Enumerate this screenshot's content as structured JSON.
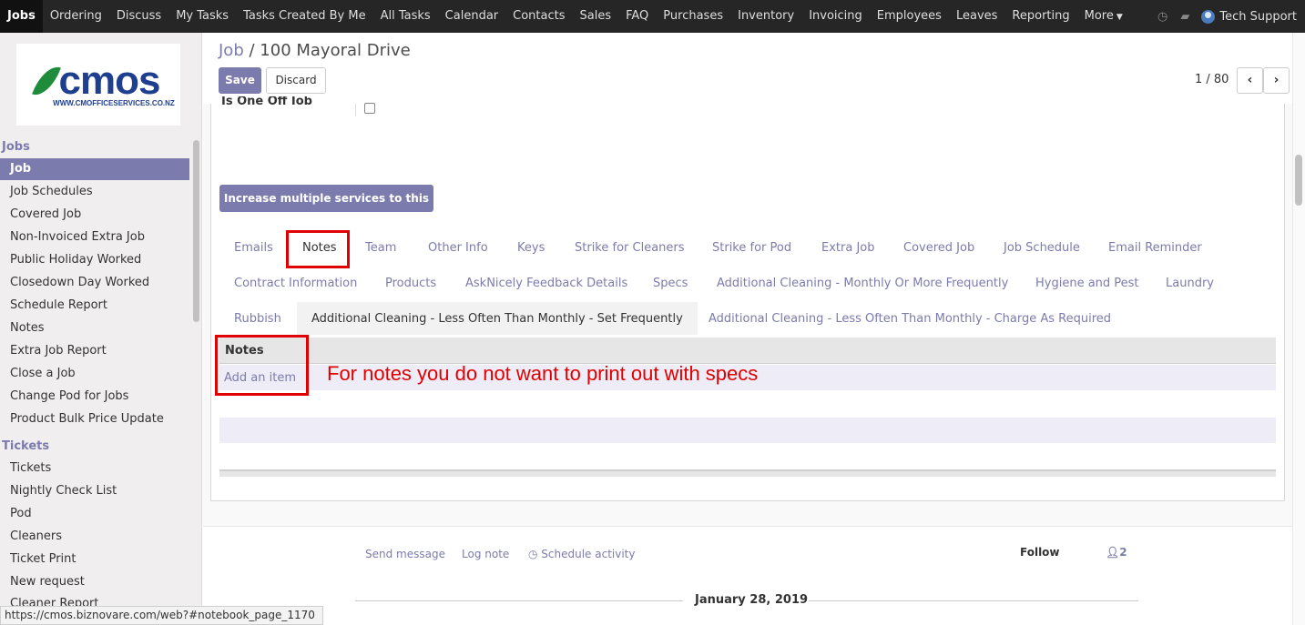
{
  "topbar": {
    "menu": [
      "Jobs",
      "Ordering",
      "Discuss",
      "My Tasks",
      "Tasks Created By Me",
      "All Tasks",
      "Calendar",
      "Contacts",
      "Sales",
      "FAQ",
      "Purchases",
      "Inventory",
      "Invoicing",
      "Employees",
      "Leaves",
      "Reporting"
    ],
    "more": "More",
    "user": "Tech Support"
  },
  "logo": {
    "text": "cmos",
    "sub": "WWW.CMOFFICESERVICES.CO.NZ"
  },
  "sidebar": {
    "section_jobs": "Jobs",
    "jobs_items": [
      "Job",
      "Job Schedules",
      "Covered Job",
      "Non-Invoiced Extra Job",
      "Public Holiday Worked",
      "Closedown Day Worked",
      "Schedule Report",
      "Notes",
      "Extra Job Report",
      "Close a Job",
      "Change Pod for Jobs",
      "Product Bulk Price Update"
    ],
    "section_tickets": "Tickets",
    "tickets_items": [
      "Tickets",
      "Nightly Check List",
      "Pod",
      "Cleaners",
      "Ticket Print",
      "New request"
    ],
    "cut_item": "Cleaner Report"
  },
  "control": {
    "breadcrumb": "Job",
    "separator": "/",
    "record": "100 Mayoral Drive",
    "save": "Save",
    "discard": "Discard",
    "pager": "1 / 80",
    "prev": "‹",
    "next": "›"
  },
  "form": {
    "cut_label": "Is One Off Job",
    "increase_button": "Increase multiple services to this Job",
    "tabs_row1": [
      "Emails",
      "Notes",
      "Team",
      "Other Info",
      "Keys",
      "Strike for Cleaners",
      "Strike for Pod",
      "Extra Job",
      "Covered Job",
      "Job Schedule",
      "Email Reminder"
    ],
    "tabs_row2": [
      "Contract Information",
      "Products",
      "AskNicely Feedback Details",
      "Specs",
      "Additional Cleaning - Monthly Or More Frequently",
      "Hygiene and Pest",
      "Laundry"
    ],
    "tabs_row3": [
      "Rubbish",
      "Additional Cleaning - Less Often Than Monthly - Set Frequently",
      "Additional Cleaning - Less Often Than Monthly - Charge As Required"
    ],
    "notes_header": "Notes",
    "add_item": "Add an item",
    "annotation": "For notes you do not want to print out with specs"
  },
  "chatter": {
    "send_message": "Send message",
    "log_note": "Log note",
    "schedule_activity": "Schedule activity",
    "follow": "Follow",
    "followers": "2",
    "date": "January 28, 2019"
  },
  "status_url": "https://cmos.biznovare.com/web?#notebook_page_1170",
  "colors": {
    "brand": "#7c7bad",
    "navbar": "#262626",
    "annotation": "#e10000"
  }
}
